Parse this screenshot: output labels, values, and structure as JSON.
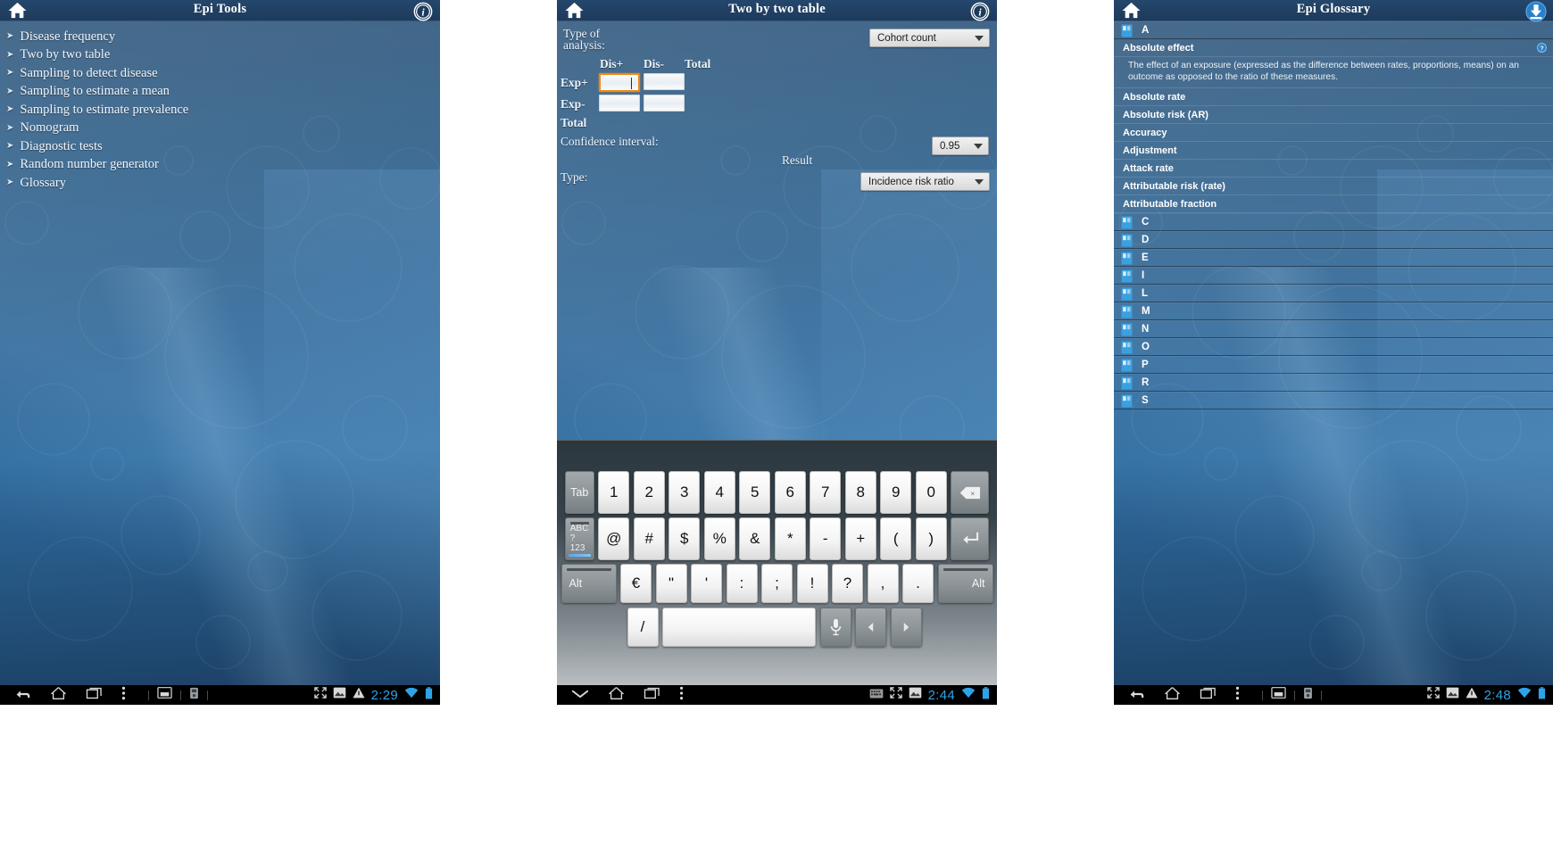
{
  "panels": [
    {
      "id": "epi-tools",
      "title": "Epi Tools",
      "home_icon": "home-icon",
      "action_icon": "info-icon",
      "menu": [
        {
          "label": "Disease frequency"
        },
        {
          "label": "Two by two table"
        },
        {
          "label": "Sampling to detect disease"
        },
        {
          "label": "Sampling to estimate a mean"
        },
        {
          "label": "Sampling to estimate prevalence"
        },
        {
          "label": "Nomogram"
        },
        {
          "label": "Diagnostic tests"
        },
        {
          "label": "Random number generator"
        },
        {
          "label": "Glossary"
        }
      ],
      "statusbar": {
        "time": "2:29"
      }
    },
    {
      "id": "two-by-two",
      "title": "Two by two table",
      "home_icon": "home-icon",
      "action_icon": "info-icon",
      "form": {
        "type_of_analysis_label": "Type of\nanalysis:",
        "type_of_analysis_line1": "Type of",
        "type_of_analysis_line2": "analysis:",
        "analysis_value": "Cohort count",
        "col_headers": [
          "Dis+",
          "Dis-",
          "Total"
        ],
        "row_headers": [
          "Exp+",
          "Exp-",
          "Total"
        ],
        "cells": [
          [
            "",
            ""
          ],
          [
            "",
            ""
          ]
        ],
        "focused_cell": "Exp+ / Dis+",
        "confidence_label": "Confidence interval:",
        "confidence_value": "0.95",
        "result_label": "Result",
        "type_label": "Type:",
        "type_value": "Incidence risk ratio"
      },
      "keyboard": {
        "row1": [
          "Tab",
          "1",
          "2",
          "3",
          "4",
          "5",
          "6",
          "7",
          "8",
          "9",
          "0",
          "backspace-icon"
        ],
        "row2": [
          "ABC",
          "?123",
          "@",
          "#",
          "$",
          "%",
          "&",
          "*",
          "-",
          "+",
          "(",
          ")",
          "enter-icon"
        ],
        "row3": [
          "Alt",
          "€",
          "\"",
          "'",
          ":",
          ";",
          "!",
          "?",
          ",",
          ".",
          "Alt"
        ],
        "row4": [
          "/",
          "space",
          "mic-icon",
          "left-arrow-icon",
          "right-arrow-icon"
        ],
        "mode_key_top": "ABC",
        "mode_key_bottom": "?123"
      },
      "statusbar": {
        "time": "2:44"
      }
    },
    {
      "id": "epi-glossary",
      "title": "Epi Glossary",
      "home_icon": "home-icon",
      "action_icon": "download-icon",
      "glossary": {
        "sections": [
          {
            "letter": "A",
            "expanded": true,
            "entries": [
              {
                "term": "Absolute effect",
                "has_help": true,
                "definition": "The effect of an exposure (expressed as the difference between rates, proportions, means) on an outcome as opposed to the ratio of these measures."
              },
              {
                "term": "Absolute rate"
              },
              {
                "term": "Absolute risk (AR)"
              },
              {
                "term": "Accuracy"
              },
              {
                "term": "Adjustment"
              },
              {
                "term": "Attack rate"
              },
              {
                "term": "Attributable risk (rate)"
              },
              {
                "term": "Attributable fraction"
              }
            ]
          },
          {
            "letter": "C",
            "expanded": false,
            "entries": []
          },
          {
            "letter": "D",
            "expanded": false,
            "entries": []
          },
          {
            "letter": "E",
            "expanded": false,
            "entries": []
          },
          {
            "letter": "I",
            "expanded": false,
            "entries": []
          },
          {
            "letter": "L",
            "expanded": false,
            "entries": []
          },
          {
            "letter": "M",
            "expanded": false,
            "entries": []
          },
          {
            "letter": "N",
            "expanded": false,
            "entries": []
          },
          {
            "letter": "O",
            "expanded": false,
            "entries": []
          },
          {
            "letter": "P",
            "expanded": false,
            "entries": []
          },
          {
            "letter": "R",
            "expanded": false,
            "entries": []
          },
          {
            "letter": "S",
            "expanded": false,
            "entries": []
          }
        ]
      },
      "statusbar": {
        "time": "2:48"
      }
    }
  ],
  "colors": {
    "accent_orange": "#f0881a",
    "clock_blue": "#2fa3e8",
    "battery_blue": "#2fa3e8",
    "panel_blue": "#22486c"
  }
}
